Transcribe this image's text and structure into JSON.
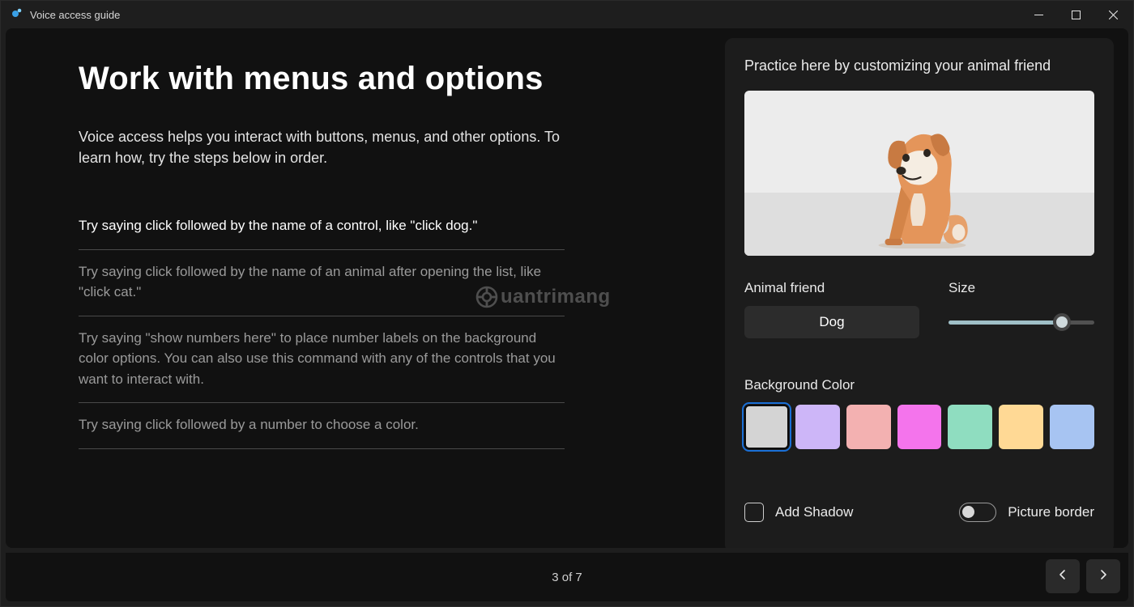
{
  "window": {
    "title": "Voice access guide"
  },
  "page": {
    "heading": "Work with menus and options",
    "intro": "Voice access helps you interact with buttons, menus, and other options. To learn how, try the steps below in order.",
    "steps": [
      "Try saying click followed by the name of a control, like \"click dog.\"",
      "Try saying click followed by the name of an animal after opening the list, like \"click cat.\"",
      "Try saying \"show numbers here\" to place number labels on the background color options. You can also use this command with any of the controls that you want to interact with.",
      "Try saying click followed by a number to choose a color."
    ],
    "indicator": "3 of 7"
  },
  "practice": {
    "title": "Practice here by customizing your animal friend",
    "animalLabel": "Animal friend",
    "animalValue": "Dog",
    "sizeLabel": "Size",
    "sizePercent": 78,
    "bgLabel": "Background Color",
    "colors": [
      "#d4d4d4",
      "#cdb6f8",
      "#f3b1b1",
      "#f474ec",
      "#8fddc0",
      "#ffd995",
      "#a7c4f2"
    ],
    "shadowLabel": "Add Shadow",
    "borderLabel": "Picture border"
  },
  "watermark": "uantrimang"
}
